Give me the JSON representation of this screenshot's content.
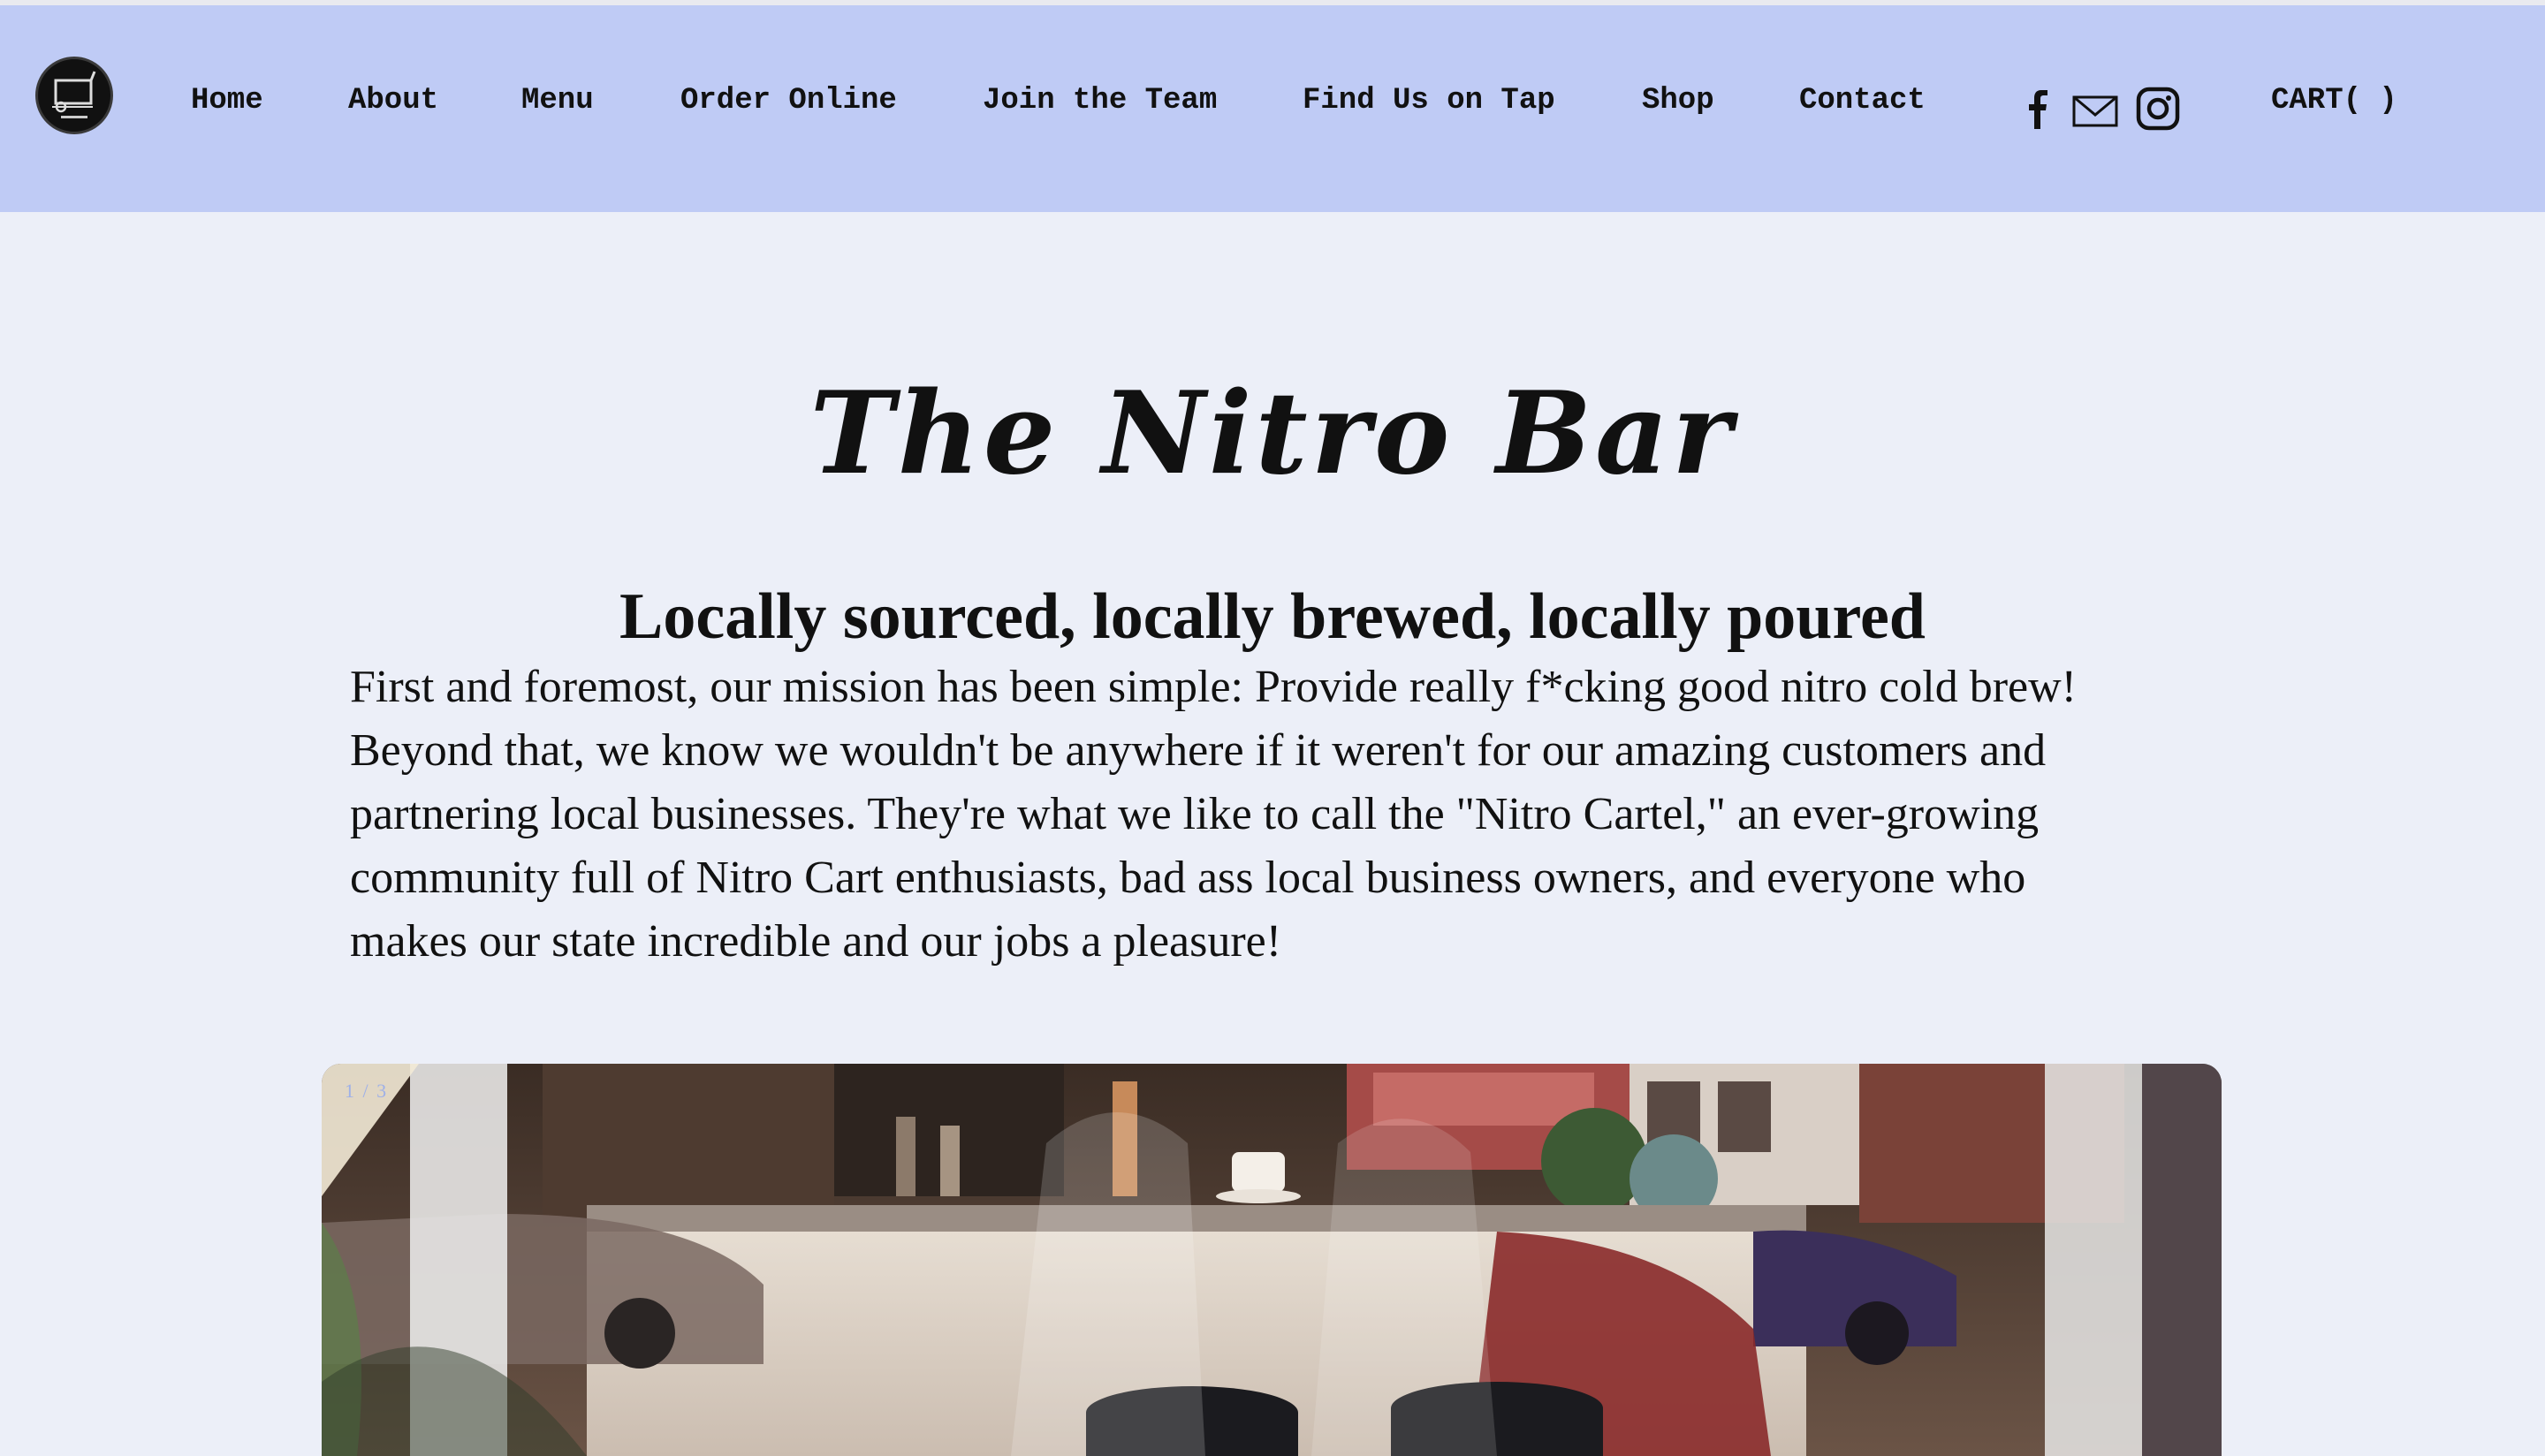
{
  "header": {
    "nav": [
      {
        "label": "Home"
      },
      {
        "label": "About"
      },
      {
        "label": "Menu"
      },
      {
        "label": "Order Online"
      },
      {
        "label": "Join the Team"
      },
      {
        "label": "Find Us on Tap"
      },
      {
        "label": "Shop"
      },
      {
        "label": "Contact"
      }
    ],
    "social": [
      "facebook-icon",
      "mail-icon",
      "instagram-icon"
    ],
    "cart_label": "CART( )"
  },
  "main": {
    "title": "The Nitro Bar",
    "subtitle": "Locally sourced, locally brewed, locally poured",
    "paragraph_lines": [
      "First and foremost, our mission has been simple: Provide really f*cking good nitro cold brew!",
      "Beyond that, we know we wouldn't be anywhere if it weren't for our amazing customers and",
      "partnering local businesses. They're what we like to call the \"Nitro Cartel,\" an ever-growing",
      "community full of Nitro Cart enthusiasts, bad ass local business owners, and everyone who",
      "makes our state incredible and our jobs a pleasure!"
    ]
  },
  "slideshow": {
    "counter": "1 / 3"
  },
  "colors": {
    "header_bg": "#bfcbf5",
    "page_bg": "#eceff8",
    "text": "#111111",
    "counter": "#9eb0e8"
  }
}
